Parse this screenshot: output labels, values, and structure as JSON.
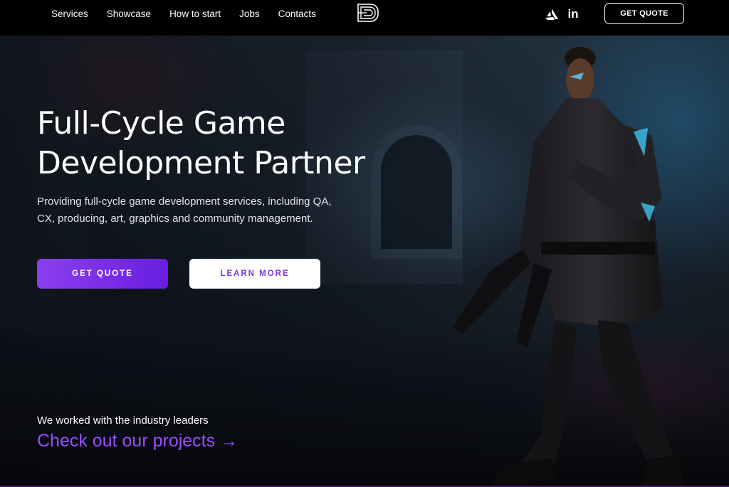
{
  "header": {
    "nav": [
      {
        "label": "Services"
      },
      {
        "label": "Showcase"
      },
      {
        "label": "How to start"
      },
      {
        "label": "Jobs"
      },
      {
        "label": "Contacts"
      }
    ],
    "logo_icon": "d-logo-icon",
    "social": [
      {
        "icon": "artstation-icon"
      },
      {
        "label": "in",
        "icon": "linkedin-icon"
      }
    ],
    "cta_label": "GET QUOTE"
  },
  "hero": {
    "title_line1": "Full-Cycle Game",
    "title_line2": "Development Partner",
    "subtitle": "Providing full-cycle game development services, including QA, CX, producing, art, graphics and community management.",
    "primary_button": "GET QUOTE",
    "secondary_button": "LEARN MORE",
    "leaders_text": "We worked with the industry leaders",
    "projects_link": "Check out our projects →"
  },
  "colors": {
    "accent": "#8a3ff0",
    "accent_link": "#9b4dff",
    "header_bg": "#000000"
  }
}
